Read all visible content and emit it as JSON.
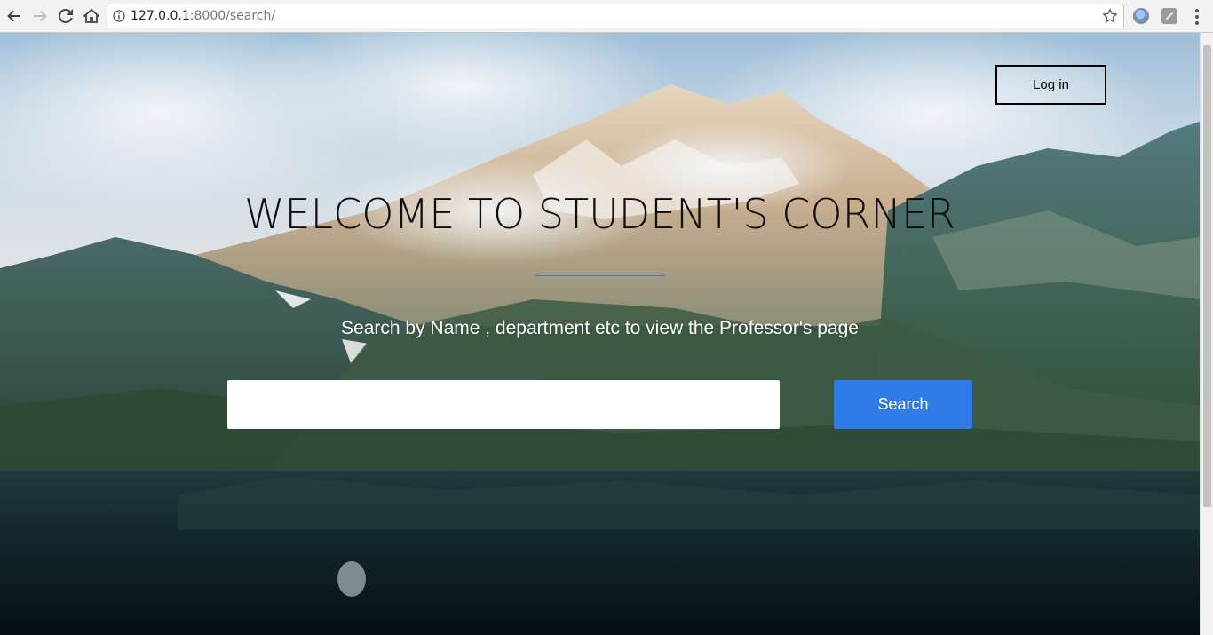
{
  "browser": {
    "url_host": "127.0.0.1",
    "url_rest": ":8000/search/",
    "icons": [
      "back-icon",
      "forward-icon",
      "reload-icon",
      "home-icon",
      "info-icon",
      "star-icon",
      "menu-icon"
    ]
  },
  "header": {
    "login_label": "Log in"
  },
  "hero": {
    "title": "WELCOME TO STUDENT'S CORNER",
    "subtitle": "Search by Name , department etc to view the Professor's page"
  },
  "search": {
    "value": "",
    "button_label": "Search",
    "accent_color": "#2f7ce6"
  }
}
